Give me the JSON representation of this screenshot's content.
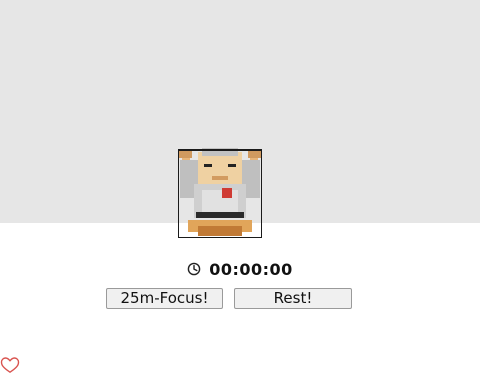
{
  "scene": {
    "character_icon": "pixel-monk-character",
    "background_color": "#e6e6e6"
  },
  "timer": {
    "icon": "clock-icon",
    "display": "00:00:00"
  },
  "controls": {
    "focus_label": "25m-Focus!",
    "rest_label": "Rest!"
  },
  "footer": {
    "heart_icon": "heart-icon",
    "heart_color": "#d9534f"
  }
}
